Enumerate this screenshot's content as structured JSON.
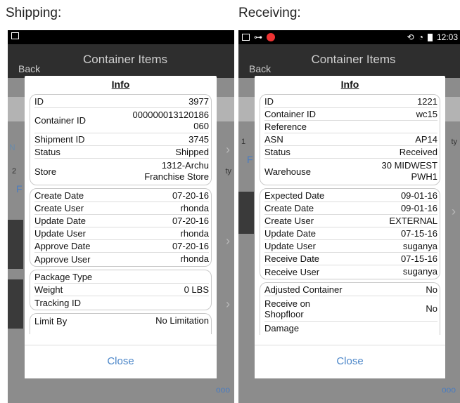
{
  "captions": {
    "shipping": "Shipping:",
    "receiving": "Receiving:"
  },
  "shipping": {
    "header": {
      "back": "Back",
      "title": "Container Items"
    },
    "info_title": "Info",
    "group1": [
      {
        "label": "ID",
        "value": "3977"
      },
      {
        "label": "Container ID",
        "value": "000000013120186\n060"
      },
      {
        "label": "Shipment ID",
        "value": "3745"
      },
      {
        "label": "Status",
        "value": "Shipped"
      },
      {
        "label": "Store",
        "value": "1312-Archu\nFranchise Store"
      }
    ],
    "group2": [
      {
        "label": "Create Date",
        "value": "07-20-16"
      },
      {
        "label": "Create User",
        "value": "rhonda"
      },
      {
        "label": "Update Date",
        "value": "07-20-16"
      },
      {
        "label": "Update User",
        "value": "rhonda"
      },
      {
        "label": "Approve Date",
        "value": "07-20-16"
      },
      {
        "label": "Approve User",
        "value": "rhonda"
      }
    ],
    "group3": [
      {
        "label": "Package Type",
        "value": ""
      },
      {
        "label": "Weight",
        "value": "0 LBS"
      },
      {
        "label": "Tracking ID",
        "value": ""
      }
    ],
    "group4": [
      {
        "label": "Limit By",
        "value": "No Limitation"
      }
    ],
    "close": "Close",
    "more": "ooo",
    "bg": {
      "n": "N",
      "two": "2",
      "f": "F",
      "ty": "ty"
    }
  },
  "receiving": {
    "statusbar_time": "12:03",
    "header": {
      "back": "Back",
      "title": "Container Items"
    },
    "info_title": "Info",
    "group1": [
      {
        "label": "ID",
        "value": "1221"
      },
      {
        "label": "Container ID",
        "value": "wc15"
      },
      {
        "label": "Reference",
        "value": ""
      },
      {
        "label": "ASN",
        "value": "AP14"
      },
      {
        "label": "Status",
        "value": "Received"
      },
      {
        "label": "Warehouse",
        "value": "30 MIDWEST\nPWH1"
      }
    ],
    "group2": [
      {
        "label": "Expected Date",
        "value": "09-01-16"
      },
      {
        "label": "Create Date",
        "value": "09-01-16"
      },
      {
        "label": "Create User",
        "value": "EXTERNAL"
      },
      {
        "label": "Update Date",
        "value": "07-15-16"
      },
      {
        "label": "Update User",
        "value": "suganya"
      },
      {
        "label": "Receive Date",
        "value": "07-15-16"
      },
      {
        "label": "Receive User",
        "value": "suganya"
      }
    ],
    "group3": [
      {
        "label": "Adjusted Container",
        "value": "No"
      },
      {
        "label": "Receive on\nShopfloor",
        "value": "No"
      },
      {
        "label": "Damage",
        "value": ""
      }
    ],
    "close": "Close",
    "more": "ooo",
    "bg": {
      "one": "1",
      "f": "F",
      "ty": "ty"
    }
  }
}
